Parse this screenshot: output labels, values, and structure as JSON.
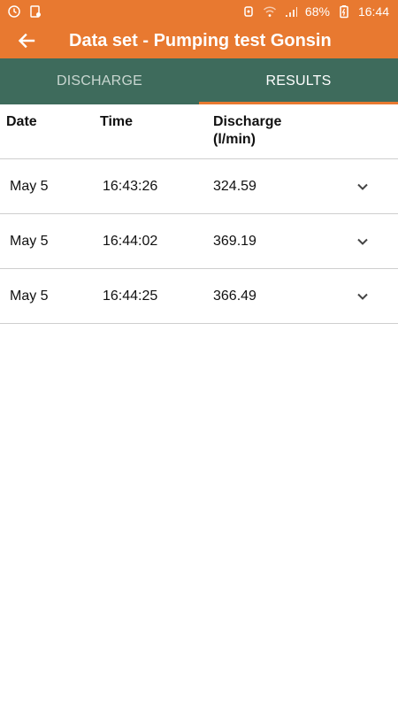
{
  "status_bar": {
    "battery": "68%",
    "time": "16:44"
  },
  "app_bar": {
    "title": "Data set - Pumping test Gonsin"
  },
  "tabs": [
    {
      "label": "DISCHARGE",
      "active": false
    },
    {
      "label": "RESULTS",
      "active": true
    }
  ],
  "table": {
    "headers": {
      "date": "Date",
      "time": "Time",
      "discharge": "Discharge",
      "discharge_unit": "(l/min)"
    },
    "rows": [
      {
        "date": "May 5",
        "time": "16:43:26",
        "discharge": "324.59"
      },
      {
        "date": "May 5",
        "time": "16:44:02",
        "discharge": "369.19"
      },
      {
        "date": "May 5",
        "time": "16:44:25",
        "discharge": "366.49"
      }
    ]
  },
  "colors": {
    "app_bar": "#e87930",
    "tab_bar": "#3e6b5c",
    "tab_indicator": "#e87930"
  },
  "icons": [
    "clock-icon",
    "sim-icon",
    "alarm-icon",
    "wifi-icon",
    "signal-icon",
    "battery-icon",
    "back-arrow-icon",
    "chevron-down-icon"
  ]
}
